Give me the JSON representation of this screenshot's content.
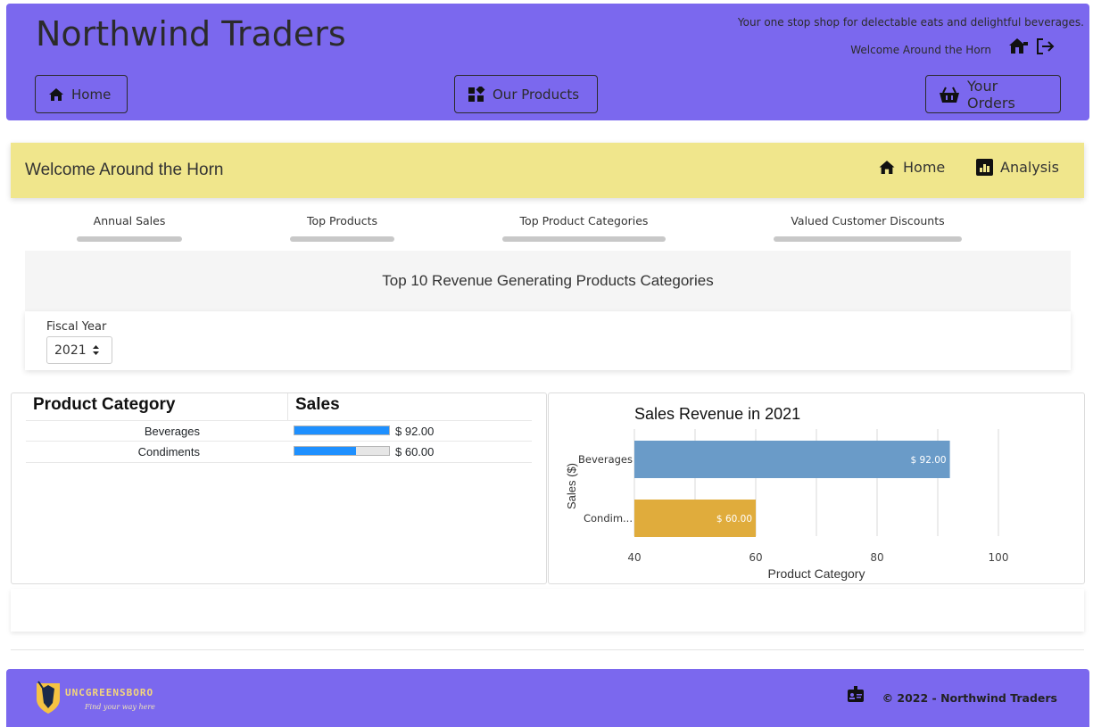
{
  "header": {
    "brand": "Northwind Traders",
    "tagline": "Your one stop shop for delectable eats and delightful beverages.",
    "welcome": "Welcome Around the Horn",
    "nav": {
      "home": "Home",
      "products": "Our Products",
      "orders": "Your Orders"
    }
  },
  "welcome_bar": {
    "text": "Welcome Around the Horn",
    "home": "Home",
    "analysis": "Analysis"
  },
  "tabs": [
    {
      "label": "Annual Sales"
    },
    {
      "label": "Top Products"
    },
    {
      "label": "Top Product Categories"
    },
    {
      "label": "Valued Customer Discounts"
    }
  ],
  "panel": {
    "title": "Top 10 Revenue Generating Products Categories",
    "fiscal_year_label": "Fiscal Year",
    "fiscal_year_value": "2021"
  },
  "grid": {
    "columns": [
      "Product Category",
      "Sales"
    ],
    "rows": [
      {
        "category": "Beverages",
        "sales_label": "$ 92.00",
        "fill": 1.0
      },
      {
        "category": "Condiments",
        "sales_label": "$ 60.00",
        "fill": 0.65
      }
    ]
  },
  "chart_data": {
    "type": "bar",
    "orientation": "horizontal",
    "title": "Sales Revenue in 2021",
    "xlabel": "Product Category",
    "ylabel": "Sales ($)",
    "categories": [
      "Beverages",
      "Condim..."
    ],
    "values": [
      92,
      60
    ],
    "data_labels": [
      "$ 92.00",
      "$ 60.00"
    ],
    "colors": [
      "#6a9bc8",
      "#e0ac3c"
    ],
    "xlim": [
      40,
      100
    ],
    "x_ticks": [
      40,
      60,
      80,
      100
    ],
    "grid": "vertical"
  },
  "footer": {
    "university": "UNCGREENSBORO",
    "university_tag": "Find your way here",
    "copyright": "© 2022 - Northwind Traders"
  },
  "colors": {
    "header_bg": "#7b68ee",
    "welcome_bar_bg": "#f0e68c",
    "grid_bar": "#1e90ff"
  }
}
